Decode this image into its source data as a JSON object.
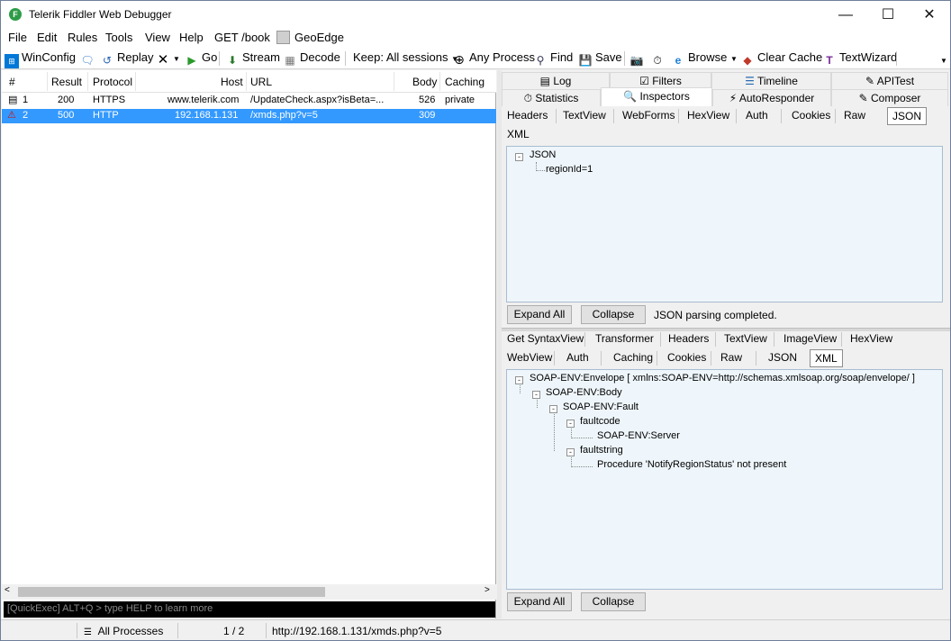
{
  "window": {
    "title": "Telerik Fiddler Web Debugger"
  },
  "menu": [
    "File",
    "Edit",
    "Rules",
    "Tools",
    "View",
    "Help",
    "GET /book",
    "GeoEdge"
  ],
  "toolbar": {
    "winconfig": "WinConfig",
    "replay": "Replay",
    "go": "Go",
    "stream": "Stream",
    "decode": "Decode",
    "keep": "Keep: All sessions",
    "any_process": "Any Process",
    "find": "Find",
    "save": "Save",
    "browse": "Browse",
    "clear_cache": "Clear Cache",
    "textwizard": "TextWizard"
  },
  "sessions": {
    "columns": [
      "#",
      "Result",
      "Protocol",
      "Host",
      "URL",
      "Body",
      "Caching"
    ],
    "rows": [
      {
        "num": "1",
        "result": "200",
        "protocol": "HTTPS",
        "host": "www.telerik.com",
        "url": "/UpdateCheck.aspx?isBeta=...",
        "body": "526",
        "caching": "private"
      },
      {
        "num": "2",
        "result": "500",
        "protocol": "HTTP",
        "host": "192.168.1.131",
        "url": "/xmds.php?v=5",
        "body": "309",
        "caching": ""
      }
    ],
    "quickexec": "[QuickExec] ALT+Q > type HELP to learn more"
  },
  "right_tabs": {
    "row1": [
      "Log",
      "Filters",
      "Timeline",
      "APITest"
    ],
    "row2": [
      "Statistics",
      "Inspectors",
      "AutoResponder",
      "Composer"
    ]
  },
  "request": {
    "tabs": [
      "Headers",
      "TextView",
      "WebForms",
      "HexView",
      "Auth",
      "Cookies",
      "Raw",
      "JSON",
      "XML"
    ],
    "tree_root": "JSON",
    "tree_child": "regionId=1",
    "expand_all": "Expand All",
    "collapse": "Collapse",
    "status": "JSON parsing completed."
  },
  "response": {
    "tabs_row1": [
      "Get SyntaxView",
      "Transformer",
      "Headers",
      "TextView",
      "ImageView",
      "HexView"
    ],
    "tabs_row2": [
      "WebView",
      "Auth",
      "Caching",
      "Cookies",
      "Raw",
      "JSON",
      "XML"
    ],
    "tree": {
      "envelope": "SOAP-ENV:Envelope [ xmlns:SOAP-ENV=http://schemas.xmlsoap.org/soap/envelope/ ]",
      "body": "SOAP-ENV:Body",
      "fault": "SOAP-ENV:Fault",
      "faultcode": "faultcode",
      "faultcode_value": "SOAP-ENV:Server",
      "faultstring": "faultstring",
      "faultstring_value": "Procedure 'NotifyRegionStatus' not present"
    },
    "expand_all": "Expand All",
    "collapse": "Collapse"
  },
  "statusbar": {
    "processes": "All Processes",
    "count": "1 / 2",
    "url": "http://192.168.1.131/xmds.php?v=5"
  }
}
